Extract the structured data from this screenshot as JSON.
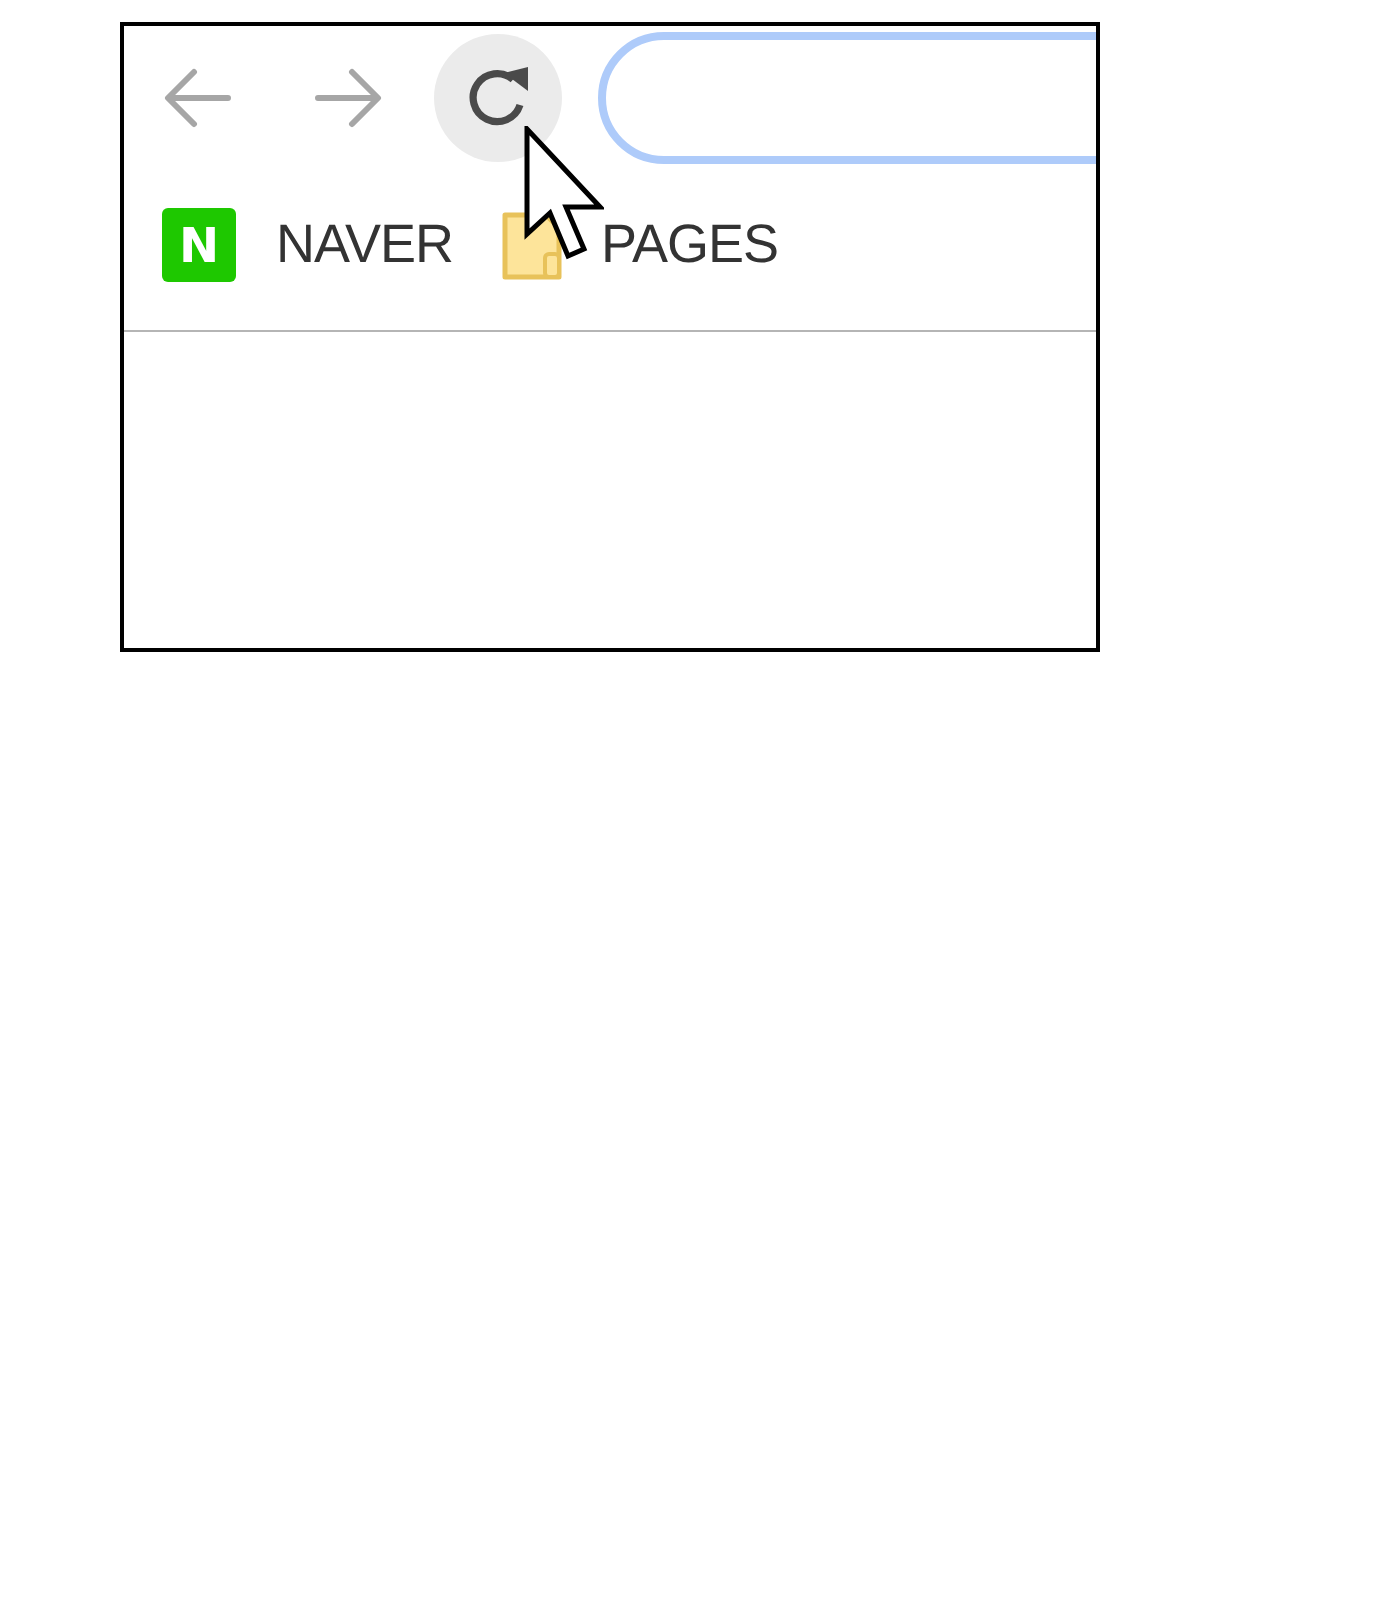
{
  "toolbar": {
    "buttons": [
      {
        "kind": "back",
        "hovered": false
      },
      {
        "kind": "forward",
        "hovered": false
      },
      {
        "kind": "reload",
        "hovered": true
      }
    ],
    "address_bar": {
      "focused": true
    }
  },
  "bookmarks": [
    {
      "kind": "site",
      "logo_text": "N",
      "label": "NAVER"
    },
    {
      "kind": "folder",
      "label": "PAGES"
    }
  ]
}
